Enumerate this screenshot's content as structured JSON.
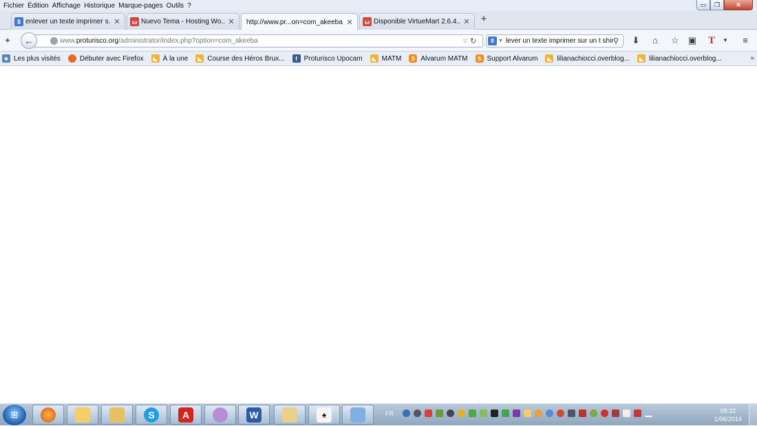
{
  "menu": {
    "items": [
      {
        "label": "Fichier"
      },
      {
        "label": "Édition"
      },
      {
        "label": "Affichage"
      },
      {
        "label": "Historique"
      },
      {
        "label": "Marque-pages"
      },
      {
        "label": "Outils"
      },
      {
        "label": "?"
      }
    ]
  },
  "window": {
    "min": "▭",
    "max": "❐",
    "close": "✕"
  },
  "tabs": [
    {
      "label": "enlever un texte imprimer s...",
      "icon": "google-icon",
      "selected": false
    },
    {
      "label": "Nuevo Tema - Hosting Wo...",
      "icon": "w-icon",
      "selected": false
    },
    {
      "label": "http://www.pr...on=com_akeeba",
      "icon": "none",
      "selected": true
    },
    {
      "label": "Disponible VirtueMart 2.6.4...",
      "icon": "w-icon",
      "selected": false
    }
  ],
  "newtab": "+",
  "nav": {
    "url_prefix": "www.",
    "url_domain": "proturisco.org",
    "url_path": "/administrator/index.php?option=com_akeeba",
    "search_value": "lever un texte imprimer sur un t shirt"
  },
  "bookmarks": [
    {
      "label": "Les plus visités",
      "icon": "most-visited-icon"
    },
    {
      "label": "Débuter avec Firefox",
      "icon": "firefox-icon"
    },
    {
      "label": "À la une",
      "icon": "rss-icon"
    },
    {
      "label": "Course des Héros Brux...",
      "icon": "rss-icon"
    },
    {
      "label": "Proturisco Upocam",
      "icon": "facebook-icon"
    },
    {
      "label": "MATM",
      "icon": "rss-icon"
    },
    {
      "label": "Alvarum MATM",
      "icon": "s-icon"
    },
    {
      "label": "Support Alvarum",
      "icon": "s-icon"
    },
    {
      "label": "lilianachiocci.overblog...",
      "icon": "rss-icon"
    },
    {
      "label": "lilianachiocci.overblog...",
      "icon": "rss-icon"
    }
  ],
  "bookmarks_more": "»",
  "taskbar": {
    "language": "FR",
    "time": "09:32",
    "date": "1/06/2014"
  }
}
